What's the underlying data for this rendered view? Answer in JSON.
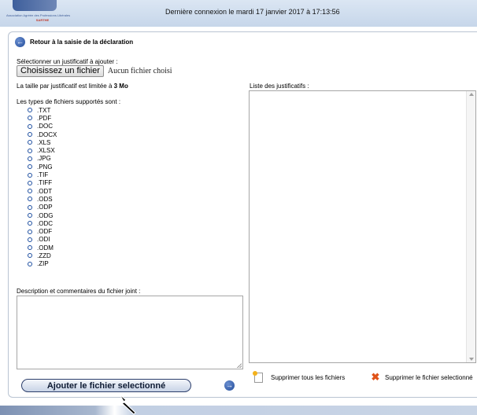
{
  "header": {
    "org_name": "Association Agréée des Professions Libérales",
    "dept_name": "SARTHE",
    "last_login": "Dernière connexion le mardi 17 janvier 2017 à 17:13:56"
  },
  "back_link": "Retour à la saisie de la déclaration",
  "upload": {
    "select_label": "Sélectionner un justificatif à ajouter :",
    "choose_button": "Choisissez un fichier",
    "no_file": "Aucun fichier choisi",
    "size_limit": "La taille par justificatif est limitée à 3 Mo",
    "types_label": "Les types de fichiers supportés sont :",
    "types": [
      ".TXT",
      ".PDF",
      ".DOC",
      ".DOCX",
      ".XLS",
      ".XLSX",
      ".JPG",
      ".PNG",
      ".TIF",
      ".TIFF",
      ".ODT",
      ".ODS",
      ".ODP",
      ".ODG",
      ".ODC",
      ".ODF",
      ".ODI",
      ".ODM",
      ".ZZD",
      ".ZIP"
    ],
    "description_label": "Description et commentaires du fichier joint :"
  },
  "list": {
    "title": "Liste des justificatifs :",
    "delete_all": "Supprimer tous les fichiers",
    "delete_selected": "Supprimer le fichier selectionné"
  },
  "actions": {
    "add_button": "Ajouter le fichier selectionné"
  },
  "icons": {
    "back": "arrow-left-icon",
    "go": "arrow-right-icon",
    "radio": "radio-icon",
    "delete_all": "document-icon",
    "delete_selected": "red-x-icon",
    "cursor": "mouse-cursor-icon"
  },
  "colors": {
    "accent_blue": "#234c99",
    "delete_red": "#e05218",
    "header_bg": "#c6d6ea"
  }
}
